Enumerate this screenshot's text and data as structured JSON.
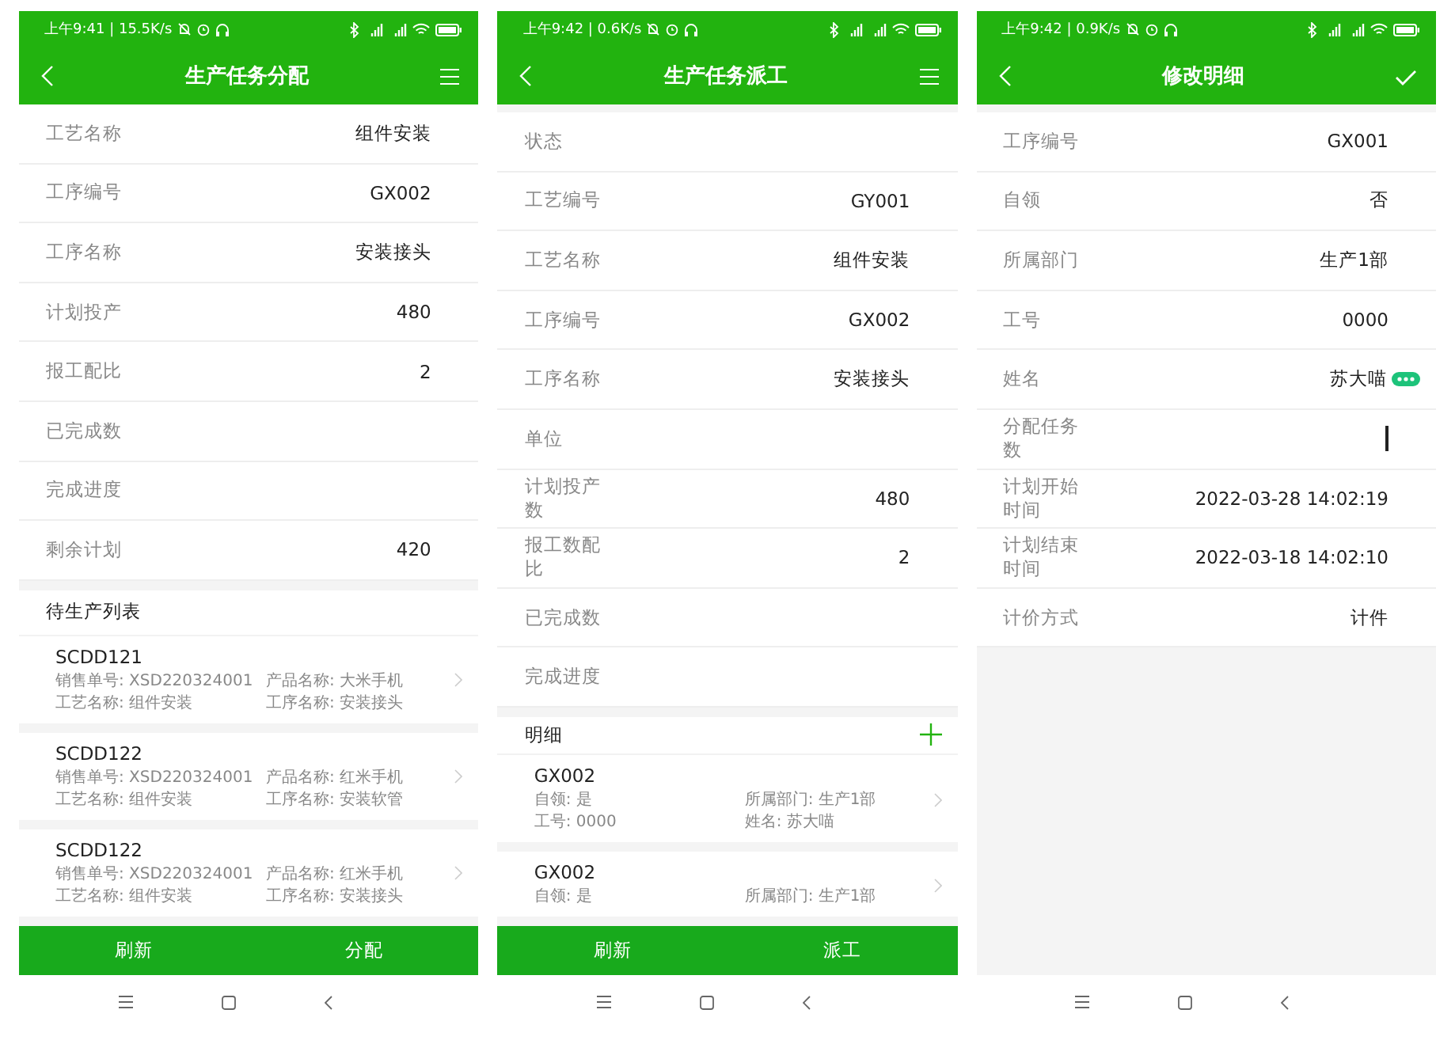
{
  "screens": [
    {
      "status_bar": {
        "time": "上午9:41 | 15.5K/s"
      },
      "title": "生产任务分配",
      "header_button": {
        "kind": "menu"
      },
      "fields": [
        {
          "label": "工艺名称",
          "value": "组件安装",
          "kind": "plain"
        },
        {
          "label": "工序编号",
          "value": "GX002",
          "kind": "plain"
        },
        {
          "label": "工序名称",
          "value": "安装接头",
          "kind": "plain"
        },
        {
          "label": "计划投产",
          "value": "480",
          "kind": "plain"
        },
        {
          "label": "报工配比",
          "value": "2",
          "kind": "plain"
        },
        {
          "label": "已完成数",
          "kind": "plain"
        },
        {
          "label": "完成进度",
          "kind": "plain"
        },
        {
          "label": "剩余计划",
          "value": "420",
          "kind": "plain"
        }
      ],
      "section": {
        "title": "待生产列表",
        "add_button": false
      },
      "cards": [
        {
          "title": "SCDD121",
          "lines": [
            [
              "销售单号: XSD220324001",
              "产品名称: 大米手机"
            ],
            [
              "工艺名称: 组件安装",
              "工序名称: 安装接头"
            ]
          ]
        },
        {
          "title": "SCDD122",
          "lines": [
            [
              "销售单号: XSD220324001",
              "产品名称: 红米手机"
            ],
            [
              "工艺名称: 组件安装",
              "工序名称: 安装软管"
            ]
          ]
        },
        {
          "title": "SCDD122",
          "lines": [
            [
              "销售单号: XSD220324001",
              "产品名称: 红米手机"
            ],
            [
              "工艺名称: 组件安装",
              "工序名称: 安装接头"
            ]
          ]
        }
      ],
      "buttons": [
        "刷新",
        "分配"
      ]
    },
    {
      "status_bar": {
        "time": "上午9:42 | 0.6K/s"
      },
      "title": "生产任务派工",
      "header_button": {
        "kind": "menu"
      },
      "fields": [
        {
          "label": "状态",
          "kind": "plain"
        },
        {
          "label": "工艺编号",
          "value": "GY001",
          "kind": "plain"
        },
        {
          "label": "工艺名称",
          "value": "组件安装",
          "kind": "plain"
        },
        {
          "label": "工序编号",
          "value": "GX002",
          "kind": "plain"
        },
        {
          "label": "工序名称",
          "value": "安装接头",
          "kind": "plain"
        },
        {
          "label": "单位",
          "kind": "plain"
        },
        {
          "label": "计划投产数",
          "value": "480",
          "kind": "plain"
        },
        {
          "label": "报工数配比",
          "value": "2",
          "kind": "plain"
        },
        {
          "label": "已完成数",
          "kind": "plain"
        },
        {
          "label": "完成进度",
          "kind": "plain"
        }
      ],
      "section": {
        "title": "明细",
        "add_button": true
      },
      "cards": [
        {
          "title": "GX002",
          "lines": [
            [
              "自领: 是",
              "所属部门: 生产1部"
            ],
            [
              "工号: 0000",
              "姓名: 苏大喵"
            ]
          ]
        },
        {
          "title": "GX002",
          "lines": [
            [
              "自领: 是",
              "所属部门: 生产1部"
            ]
          ]
        }
      ],
      "buttons": [
        "刷新",
        "派工"
      ]
    },
    {
      "status_bar": {
        "time": "上午9:42 | 0.9K/s"
      },
      "title": "修改明细",
      "header_button": {
        "kind": "confirm"
      },
      "fields": [
        {
          "label": "工序编号",
          "value": "GX001",
          "kind": "plain"
        },
        {
          "label": "自领",
          "value": "否",
          "kind": "plain"
        },
        {
          "label": "所属部门",
          "value": "生产1部",
          "kind": "plain"
        },
        {
          "label": "工号",
          "value": "0000",
          "kind": "plain"
        },
        {
          "label": "姓名",
          "value": "苏大喵",
          "kind": "lookup"
        },
        {
          "label": "分配任务数",
          "kind": "input"
        },
        {
          "label": "计划开始时间",
          "value": "2022-03-28 14:02:19",
          "kind": "plain"
        },
        {
          "label": "计划结束时间",
          "value": "2022-03-18 14:02:10",
          "kind": "plain"
        },
        {
          "label": "计价方式",
          "value": "计件",
          "kind": "plain"
        }
      ]
    }
  ]
}
